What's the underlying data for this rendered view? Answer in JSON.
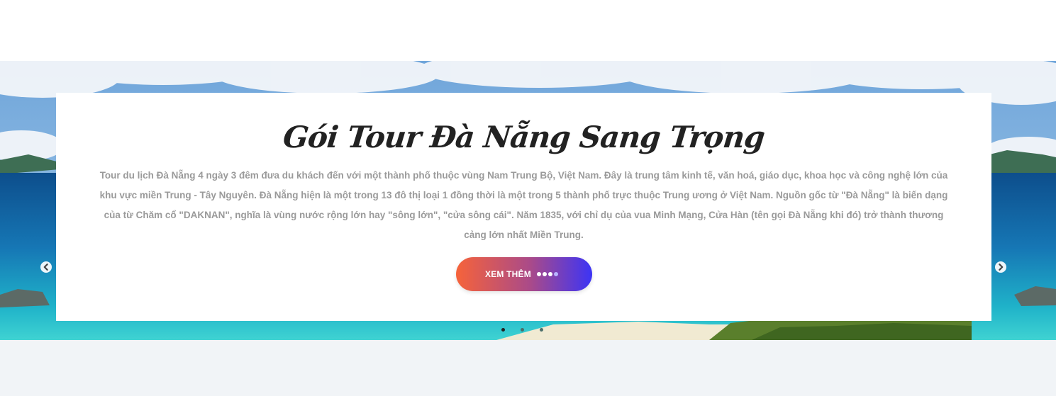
{
  "hero": {
    "title": "Gói Tour Đà Nẵng Sang Trọng",
    "description": "Tour du lịch Đà Nẵng 4 ngày 3 đêm đưa du khách đến với một thành phố thuộc vùng Nam Trung Bộ, Việt Nam. Đây là trung tâm kinh tế, văn hoá, giáo dục, khoa học và công nghệ lớn của khu vực miền Trung - Tây Nguyên. Đà Nẵng hiện là một trong 13 đô thị loại 1 đồng thời là một trong 5 thành phố trực thuộc Trung ương ở Việt Nam. Nguồn gốc từ \"Đà Nẵng\" là biến dạng của từ Chăm cổ \"DAKNAN\", nghĩa là vùng nước rộng lớn hay \"sông lớn\", \"cửa sông cái\". Năm 1835, với chỉ dụ của vua Minh Mạng, Cửa Hàn (tên gọi Đà Nẵng khi đó) trở thành thương cảng lớn nhất Miền Trung.",
    "cta_label": "XEM THÊM",
    "cta_gradient": [
      "#f6633a",
      "#a94a8a",
      "#3c34f5"
    ],
    "cta_dot_colors": [
      "#ffffff",
      "#ffffff",
      "#ffffff",
      "#b9b4ff"
    ]
  },
  "carousel": {
    "prev_icon": "chevron-left-icon",
    "next_icon": "chevron-right-icon",
    "slide_count": 3,
    "active_index": 0,
    "dot_active_color": "#222222",
    "dot_inactive_color": "#4a6e6a"
  },
  "colors": {
    "page_bg": "#ffffff",
    "bottom_band": "#f1f4f7",
    "title": "#222222",
    "description": "#9a9a9a"
  }
}
